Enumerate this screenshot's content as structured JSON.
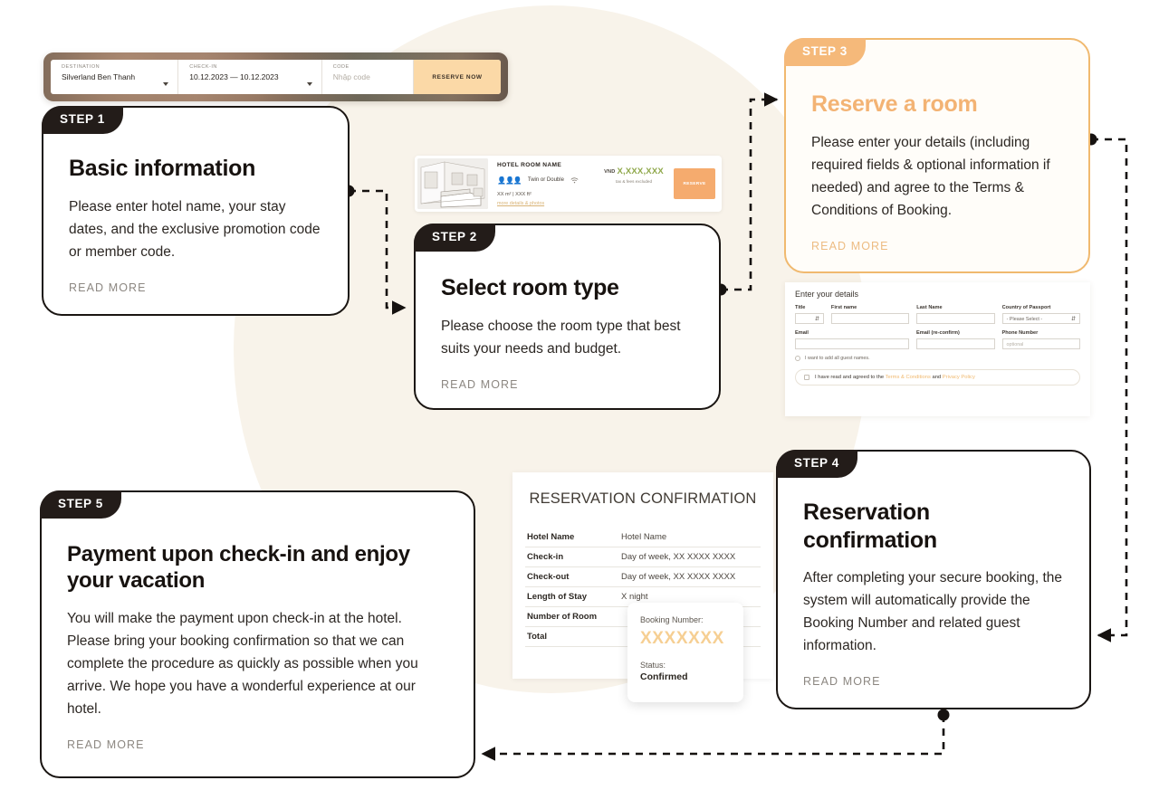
{
  "theme": {
    "ink": "#1a1512",
    "accent": "#f0b96f",
    "accent_soft": "#fbd9a7",
    "bg_blob": "#f8f3ea",
    "price_green": "#8fa84b"
  },
  "steps": [
    {
      "tab": "STEP 1",
      "title": "Basic information",
      "text": "Please enter hotel name, your stay dates, and the exclusive promotion code or member code.",
      "read_more": "READ MORE"
    },
    {
      "tab": "STEP 2",
      "title": "Select room type",
      "text": "Please choose the room type that best suits your needs and budget.",
      "read_more": "READ MORE"
    },
    {
      "tab": "STEP 3",
      "title": "Reserve a room",
      "text": "Please enter your details (including required fields & optional information if needed) and agree to the Terms & Conditions of Booking.",
      "read_more": "READ MORE"
    },
    {
      "tab": "STEP 4",
      "title": "Reservation confirmation",
      "text": "After completing your secure booking, the system will automatically provide the Booking Number and related guest information.",
      "read_more": "READ MORE"
    },
    {
      "tab": "STEP 5",
      "title": "Payment upon check-in and enjoy your vacation",
      "text": "You will make the payment upon check-in at the hotel. Please bring your booking confirmation so that we can complete the procedure as quickly as possible when you arrive. We hope you have a wonderful experience at our hotel.",
      "read_more": "READ MORE"
    }
  ],
  "search_bar": {
    "destination_label": "DESTINATION",
    "destination_value": "Silverland Ben Thanh",
    "checkin_label": "CHECK-IN",
    "checkin_value": "10.12.2023  —  10.12.2023",
    "code_label": "CODE",
    "code_placeholder": "Nhập code",
    "reserve_button": "RESERVE NOW"
  },
  "room_card": {
    "name": "HOTEL ROOM NAME",
    "bed": "Twin or Double",
    "size": "XX m² | XXX ft²",
    "link": "more details & photos",
    "currency": "VND",
    "price": "X,XXX,XXX",
    "tax_note": "tax & fees excluded",
    "reserve_button": "RESERVE"
  },
  "details_form": {
    "title": "Enter your details",
    "fields": [
      {
        "label": "Title",
        "value": ""
      },
      {
        "label": "First name",
        "value": ""
      },
      {
        "label": "Last Name",
        "value": ""
      },
      {
        "label": "Country of Passport",
        "value": "- Please Select -"
      },
      {
        "label": "Email",
        "value": ""
      },
      {
        "label": "Email (re-confirm)",
        "value": ""
      },
      {
        "label": "Phone Number",
        "value": "optional"
      }
    ],
    "guest_checkbox": "I want to add all guest names.",
    "terms_prefix": "I have read and agreed to the",
    "terms_link": "Terms & Conditions",
    "terms_and": "and",
    "privacy_link": "Privacy Policy"
  },
  "confirmation": {
    "title": "RESERVATION CONFIRMATION",
    "rows": [
      {
        "key": "Hotel Name",
        "value": "Hotel Name"
      },
      {
        "key": "Check-in",
        "value": "Day of week, XX XXXX XXXX"
      },
      {
        "key": "Check-out",
        "value": "Day of week, XX XXXX XXXX"
      },
      {
        "key": "Length of Stay",
        "value": "X night"
      },
      {
        "key": "Number of Room",
        "value": ""
      },
      {
        "key": "Total",
        "value": ""
      }
    ]
  },
  "booking_popup": {
    "number_label": "Booking Number:",
    "number": "XXXXXXX",
    "status_label": "Status:",
    "status": "Confirmed"
  }
}
